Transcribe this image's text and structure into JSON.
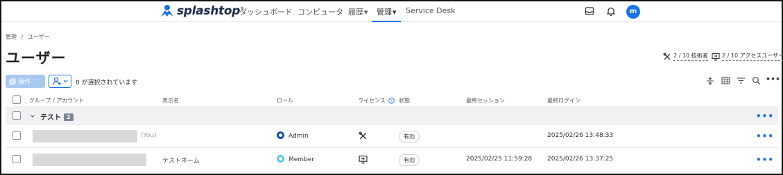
{
  "nav": {
    "logo_text": "splashtop",
    "logo_reg": "®",
    "items": [
      "ダッシュボード",
      "コンピュータ",
      "履歴",
      "管理",
      "Service Desk"
    ],
    "avatar_initial": "m",
    "accent": "#1a73e8"
  },
  "breadcrumb": {
    "parent": "管理",
    "sep": "/",
    "current": "ユーザー"
  },
  "page_title": "ユーザー",
  "license_stats": {
    "technicians": "2 / 10 技術者",
    "access_users": "2 / 10 アクセスユーザー"
  },
  "toolbar": {
    "ops_label": "操作",
    "selected_text": "0 が選択されています"
  },
  "table": {
    "headers": {
      "group_account": "グループ / アカウント",
      "display_name": "表示名",
      "role": "ロール",
      "license": "ライセンス",
      "status": "状態",
      "last_session": "最終セッション",
      "last_login": "最終ログイン"
    },
    "group": {
      "name": "テスト",
      "count": "2"
    },
    "rows": [
      {
        "you_label": "(You)",
        "display_name": "",
        "role": "Admin",
        "license_icon": "tools-icon",
        "status": "有効",
        "last_session": "",
        "last_login": "2025/02/26 13:48:33"
      },
      {
        "you_label": "",
        "display_name": "テストネーム",
        "role": "Member",
        "license_icon": "remote-access-icon",
        "status": "有効",
        "last_session": "2025/02/25 11:59:28",
        "last_login": "2025/02/26 13:37:25"
      }
    ]
  },
  "more_label": "•••"
}
